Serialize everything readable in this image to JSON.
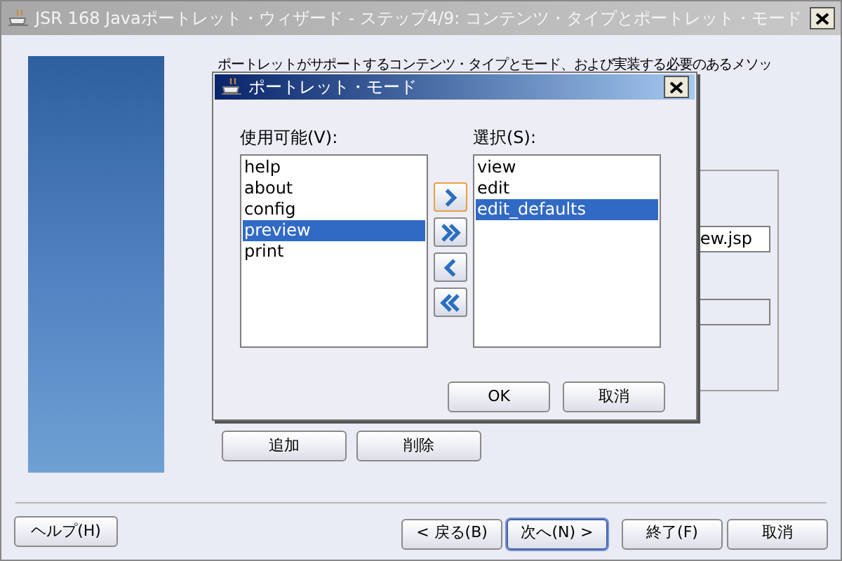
{
  "window": {
    "title": "JSR 168 Javaポートレット・ウィザード - ステップ4/9: コンテンツ・タイプとポートレット・モード"
  },
  "description": "ポートレットがサポートするコンテンツ・タイプとモード、および実装する必要のあるメソッ",
  "group": {
    "field_value": "ew.jsp"
  },
  "group_buttons": [
    "追加",
    "削除"
  ],
  "footer": {
    "help": "ヘルプ(H)",
    "buttons": [
      {
        "label": "< 戻る(B)",
        "default": false
      },
      {
        "label": "次へ(N) >",
        "default": true
      },
      {
        "label": "終了(F)",
        "default": false
      },
      {
        "label": "取消",
        "default": false
      }
    ]
  },
  "dialog": {
    "title": "ポートレット・モード",
    "available": {
      "label": "使用可能(V):",
      "items": [
        {
          "label": "help",
          "selected": false
        },
        {
          "label": "about",
          "selected": false
        },
        {
          "label": "config",
          "selected": false
        },
        {
          "label": "preview",
          "selected": true
        },
        {
          "label": "print",
          "selected": false
        }
      ]
    },
    "selected_list": {
      "label": "選択(S):",
      "items": [
        {
          "label": "view",
          "selected": false
        },
        {
          "label": "edit",
          "selected": false
        },
        {
          "label": "edit_defaults",
          "selected": true
        }
      ]
    },
    "move_buttons": [
      {
        "kind": "add",
        "focused": true
      },
      {
        "kind": "add_all",
        "focused": false
      },
      {
        "kind": "remove",
        "focused": false
      },
      {
        "kind": "remove_all",
        "focused": false
      }
    ],
    "buttons": [
      "OK",
      "取消"
    ]
  }
}
